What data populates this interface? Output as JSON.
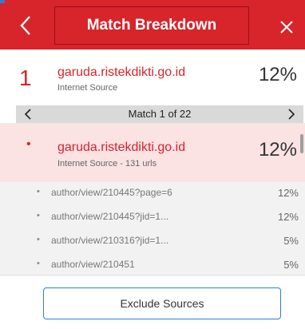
{
  "header": {
    "title": "Match Breakdown",
    "back_icon": "chevron-left-icon",
    "close_icon": "close-icon"
  },
  "source": {
    "number": "1",
    "name": "garuda.ristekdikti.go.id",
    "type": "Internet Source",
    "percent": "12%"
  },
  "match_nav": {
    "label": "Match 1 of 22",
    "prev_icon": "chevron-left-icon",
    "next_icon": "chevron-right-icon"
  },
  "highlighted_source": {
    "bullet": "•",
    "name": "garuda.ristekdikti.go.id",
    "subtitle": "Internet Source - 131 urls",
    "percent": "12%"
  },
  "urls": [
    {
      "bullet": "•",
      "url": "author/view/210445?page=6",
      "percent": "12%"
    },
    {
      "bullet": "•",
      "url": "author/view/210445?jid=1...",
      "percent": "12%"
    },
    {
      "bullet": "•",
      "url": "author/view/210316?jid=1...",
      "percent": "5%"
    },
    {
      "bullet": "•",
      "url": "author/view/210451",
      "percent": "5%"
    }
  ],
  "footer": {
    "exclude_label": "Exclude Sources"
  },
  "colors": {
    "brand_red": "#d8242b",
    "highlight_bg": "#fbe2e3",
    "button_border": "#2f7fd1"
  }
}
